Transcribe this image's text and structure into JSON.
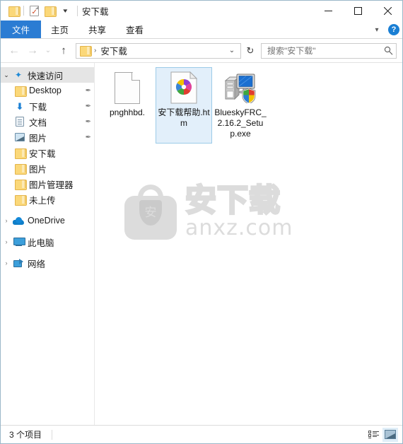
{
  "window": {
    "title": "安下载",
    "quick_access_toolbar": [
      {
        "name": "folder-properties-icon",
        "icon": "folder-icon"
      },
      {
        "name": "properties-icon",
        "icon": "doc-check-icon"
      },
      {
        "name": "new-folder-icon",
        "icon": "folder-icon"
      },
      {
        "name": "customize-qat-dropdown",
        "icon": "chevron-down-icon"
      }
    ],
    "controls": {
      "minimize": "—",
      "maximize": "☐",
      "close": "✕"
    }
  },
  "ribbon": {
    "tabs": [
      {
        "label": "文件",
        "active": true
      },
      {
        "label": "主页",
        "active": false
      },
      {
        "label": "共享",
        "active": false
      },
      {
        "label": "查看",
        "active": false
      }
    ],
    "collapse_icon": "chevron-down-icon",
    "help_label": "?"
  },
  "addressbar": {
    "back_icon": "←",
    "forward_icon": "→",
    "recent_icon": "⌄",
    "up_icon": "↑",
    "breadcrumb_separator": "›",
    "breadcrumb": "安下载",
    "dropdown_icon": "⌄",
    "refresh_icon": "↻",
    "search": {
      "placeholder": "搜索\"安下载\"",
      "value": "",
      "icon": "search-icon"
    }
  },
  "sidebar": {
    "groups": [
      {
        "label": "快速访问",
        "icon": "star-pin-icon",
        "expanded": true,
        "selected": true,
        "chevron": "⌄",
        "items": [
          {
            "label": "Desktop",
            "icon": "folder-icon",
            "pinned": true
          },
          {
            "label": "下载",
            "icon": "download-arrow-icon",
            "pinned": true
          },
          {
            "label": "文档",
            "icon": "document-icon",
            "pinned": true
          },
          {
            "label": "图片",
            "icon": "pictures-icon",
            "pinned": true
          },
          {
            "label": "安下载",
            "icon": "folder-icon",
            "pinned": false
          },
          {
            "label": "图片",
            "icon": "folder-icon",
            "pinned": false
          },
          {
            "label": "图片管理器",
            "icon": "folder-icon",
            "pinned": false
          },
          {
            "label": "未上传",
            "icon": "folder-icon",
            "pinned": false
          }
        ]
      }
    ],
    "roots": [
      {
        "label": "OneDrive",
        "icon": "cloud-icon",
        "chevron": "›"
      },
      {
        "label": "此电脑",
        "icon": "this-pc-icon",
        "chevron": "›"
      },
      {
        "label": "网络",
        "icon": "network-icon",
        "chevron": "›"
      }
    ],
    "pin_glyph": "✒"
  },
  "files": [
    {
      "name": "pnghhbd.",
      "icon": "blank-document-icon",
      "selected": false
    },
    {
      "name": "安下载帮助.htm",
      "icon": "html-pinwheel-icon",
      "selected": true
    },
    {
      "name": "BlueskyFRC_2.16.2_Setup.exe",
      "icon": "setup-exe-icon",
      "selected": false
    }
  ],
  "watermark": {
    "shield_char": "安",
    "brand": "安下载",
    "url": "anxz.com"
  },
  "statusbar": {
    "item_count": "3 个项目",
    "views": [
      {
        "name": "details-view-button",
        "icon": "details-view-icon",
        "active": false
      },
      {
        "name": "large-icons-view-button",
        "icon": "large-icons-view-icon",
        "active": true
      }
    ]
  },
  "colors": {
    "accent": "#2b7cd3",
    "selection_bg": "#e2effa",
    "selection_border": "#9ccbe8",
    "folder_yellow": "#fbd879",
    "watermark_gray": "#dcdcdc"
  }
}
